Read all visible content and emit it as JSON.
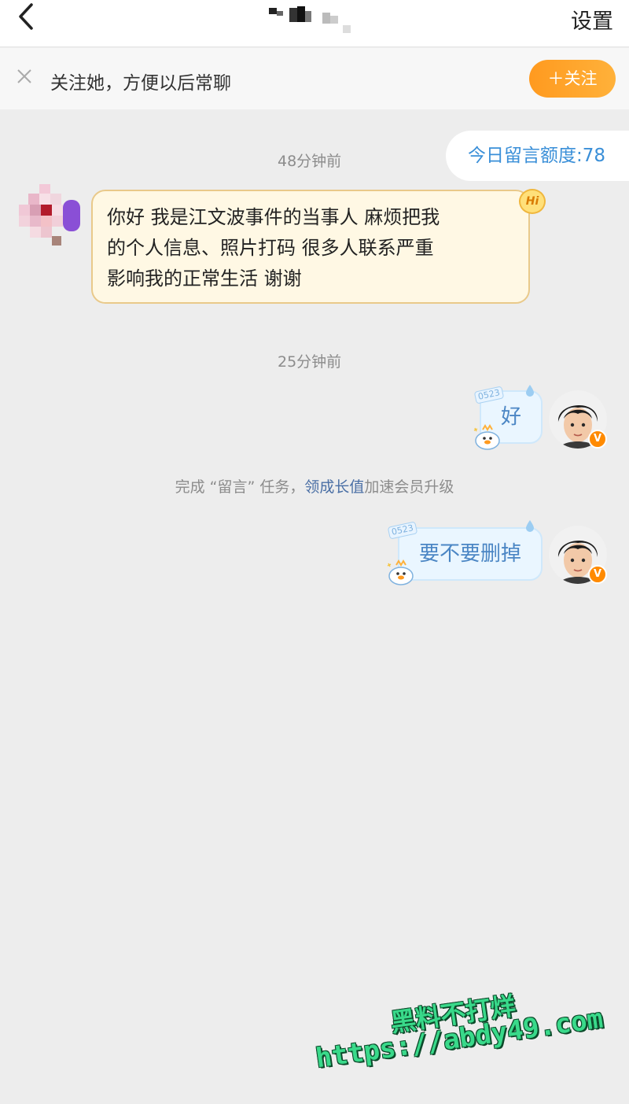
{
  "header": {
    "settings_label": "设置"
  },
  "follow_bar": {
    "prompt": "关注她，方便以后常聊",
    "follow_button": "＋关注"
  },
  "quota": {
    "text": "今日留言额度:78"
  },
  "messages": [
    {
      "timestamp": "48分钟前",
      "direction": "incoming",
      "lines": [
        "你好 我是江文波事件的当事人 麻烦把我",
        "的个人信息、照片打码 很多人联系严重",
        "影响我的正常生活 谢谢"
      ],
      "badge": "Hi"
    },
    {
      "timestamp": "25分钟前",
      "direction": "outgoing",
      "text": "好",
      "deco_tag": "0523",
      "avatar_badge": "V"
    },
    {
      "direction": "outgoing",
      "text": "要不要删掉",
      "deco_tag": "0523",
      "avatar_badge": "V"
    }
  ],
  "system_tip": {
    "prefix": "完成 “留言” 任务，",
    "link": "领成长值",
    "suffix": "加速会员升级"
  },
  "watermark": {
    "line1": "黑料不打烊",
    "line2": "https://abdy49.com"
  },
  "colors": {
    "accent_orange": "#ff9a1f",
    "link_blue": "#3a8fd8",
    "incoming_bubble": "#fff8e4",
    "outgoing_bubble": "#eaf6ff",
    "watermark_green": "#39d98a"
  }
}
